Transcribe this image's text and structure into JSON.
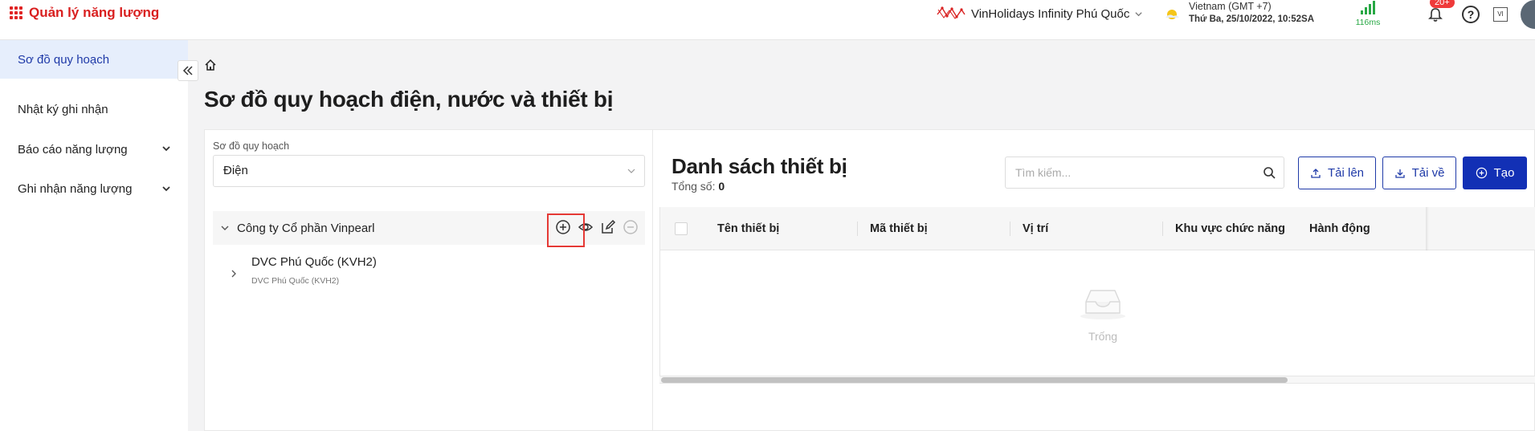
{
  "app": {
    "title": "Quản lý năng lượng",
    "icon": "grid-menu-icon"
  },
  "header": {
    "site_name": "VinHolidays Infinity Phú Quốc",
    "timezone": "Vietnam (GMT +7)",
    "datetime": "Thứ Ba, 25/10/2022, 10:52SA",
    "latency": "116ms",
    "notification_count": "20+",
    "help_label": "?",
    "language": "VI"
  },
  "sidebar": {
    "items": [
      {
        "label": "Sơ đồ quy hoạch",
        "active": true
      },
      {
        "label": "Nhật ký ghi nhận"
      },
      {
        "label": "Báo cáo năng lượng",
        "expandable": true
      },
      {
        "label": "Ghi nhận năng lượng",
        "expandable": true
      }
    ]
  },
  "page": {
    "title": "Sơ đồ quy hoạch điện, nước và thiết bị"
  },
  "left_panel": {
    "field_label": "Sơ đồ quy hoạch",
    "select_value": "Điện",
    "tree": {
      "root": "Công ty Cổ phần Vinpearl",
      "child_title": "DVC Phú Quốc (KVH2)",
      "child_subtitle": "DVC Phú Quốc (KVH2)"
    }
  },
  "right_panel": {
    "title": "Danh sách thiết bị",
    "total_label": "Tổng số:",
    "total_value": "0",
    "search_placeholder": "Tìm kiếm...",
    "upload_label": "Tải lên",
    "download_label": "Tải về",
    "create_label": "Tạo",
    "columns": [
      "Tên thiết bị",
      "Mã thiết bị",
      "Vị trí",
      "Khu vực chức năng",
      "Hành động"
    ],
    "empty_text": "Trống"
  },
  "colors": {
    "brand_red": "#d92020",
    "primary_blue": "#1230b5",
    "active_bg": "#e6eefc",
    "signal_green": "#27a844"
  }
}
